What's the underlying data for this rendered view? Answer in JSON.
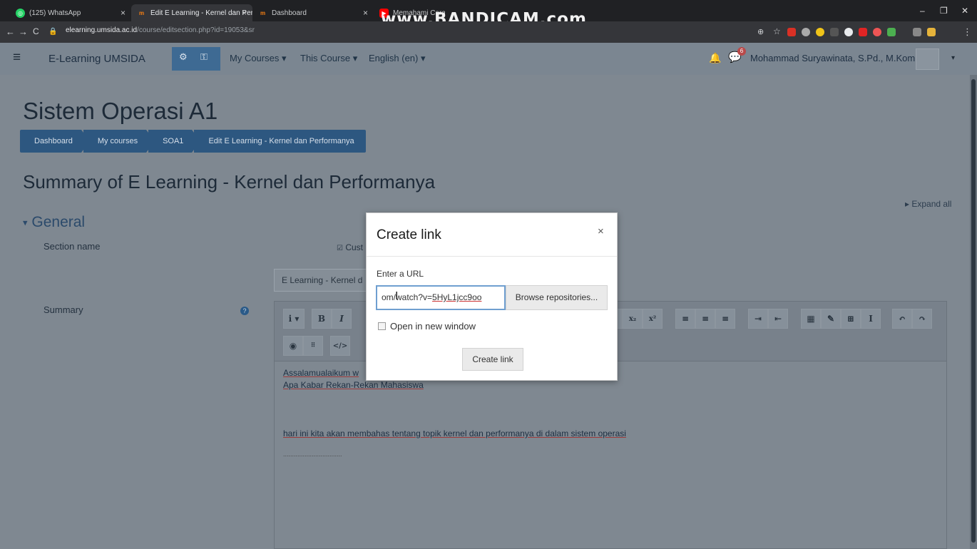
{
  "browser": {
    "tabs": [
      {
        "title": "(125) WhatsApp",
        "icon": "whatsapp-icon",
        "color": "#25d366"
      },
      {
        "title": "Edit E Learning - Kernel dan Perfo",
        "icon": "moodle-icon",
        "color": "#f98012"
      },
      {
        "title": "Dashboard",
        "icon": "moodle-icon",
        "color": "#f98012"
      },
      {
        "title": "Memahami Cara Ke",
        "icon": "youtube-icon",
        "color": "#ff0000"
      }
    ],
    "watermark": "www.BANDICAM.com",
    "url_host": "elearning.umsida.ac.id",
    "url_path": "/course/editsection.php?id=19053&sr"
  },
  "navbar": {
    "brand": "E-Learning UMSIDA",
    "menus": [
      "My Courses",
      "This Course",
      "English (en)"
    ],
    "notification_count": "6",
    "user_name": "Mohammad Suryawinata, S.Pd., M.Kom"
  },
  "page": {
    "course_title": "Sistem Operasi A1",
    "breadcrumbs": [
      "Dashboard",
      "My courses",
      "SOA1",
      "Edit E Learning - Kernel dan Performanya"
    ],
    "summary_heading": "Summary of E Learning - Kernel dan Performanya",
    "expand_all": "Expand all",
    "general_heading": "General",
    "section_name_label": "Section name",
    "custom_label": "Cust",
    "section_name_value": "E Learning - Kernel d",
    "summary_label": "Summary"
  },
  "editor": {
    "content_lines": [
      "Assalamualaikum w",
      "Apa Kabar Rekan-Rekan Mahasiswa",
      "hari ini kita akan membahas tentang topik kernel dan performanya di dalam sistem operasi",
      "................................."
    ]
  },
  "modal": {
    "title": "Create link",
    "url_label": "Enter a URL",
    "url_value_plain": "om/watch?v=",
    "url_value_id": "5HyL1jcc9oo",
    "browse_label": "Browse repositories...",
    "new_window_label": "Open in new window",
    "create_label": "Create link"
  }
}
